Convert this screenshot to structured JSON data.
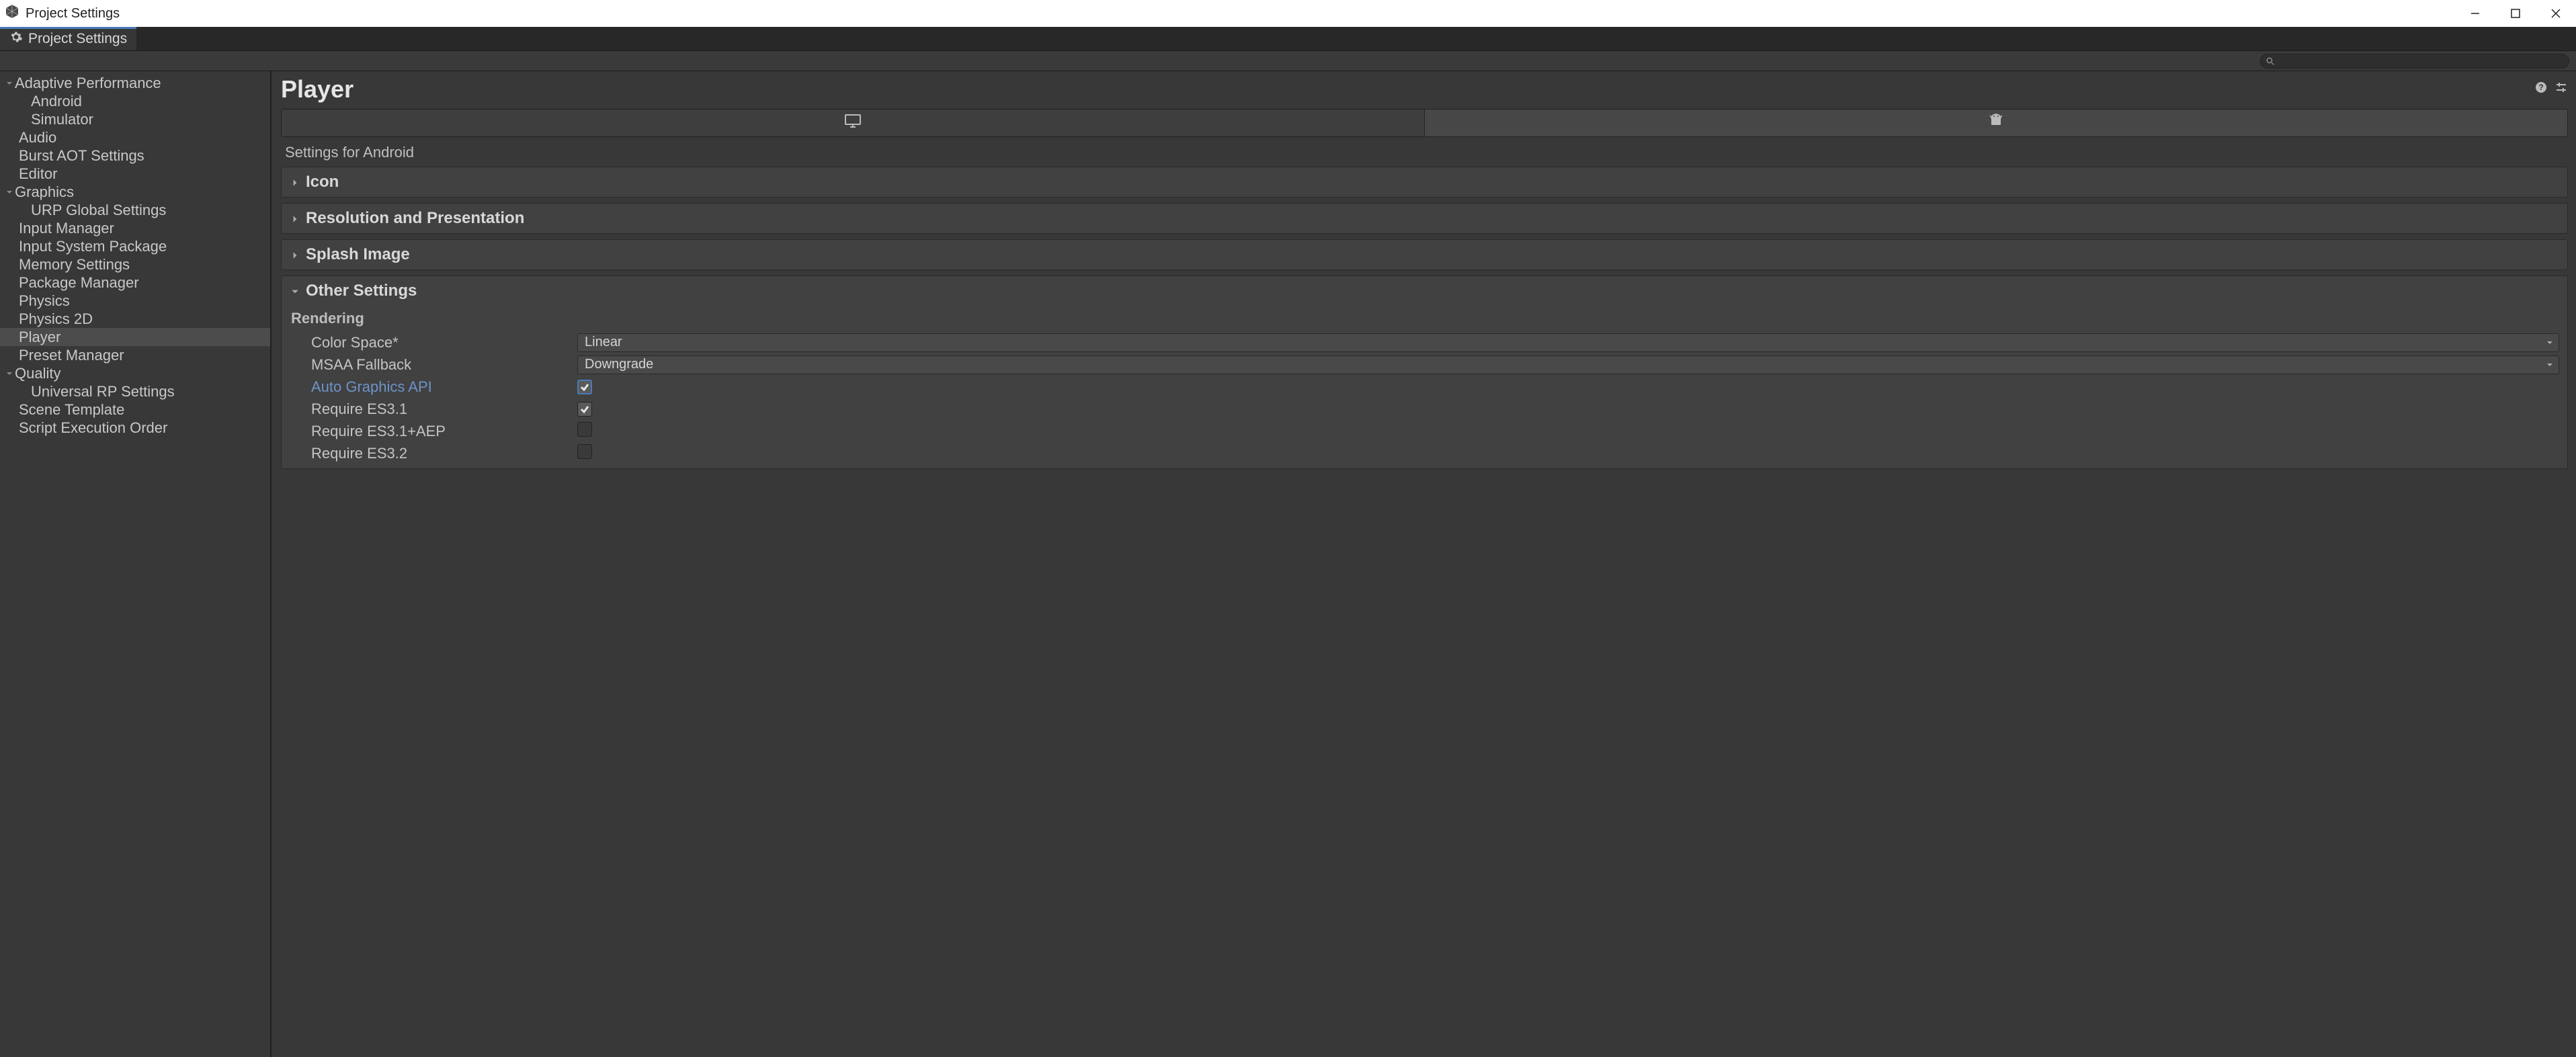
{
  "window": {
    "title": "Project Settings"
  },
  "tab": {
    "label": "Project Settings"
  },
  "search": {
    "placeholder": ""
  },
  "sidebar": {
    "items": {
      "adaptive": "Adaptive Performance",
      "android": "Android",
      "simulator": "Simulator",
      "audio": "Audio",
      "burst": "Burst AOT Settings",
      "editor": "Editor",
      "graphics": "Graphics",
      "urp": "URP Global Settings",
      "input_manager": "Input Manager",
      "input_system": "Input System Package",
      "memory": "Memory Settings",
      "package_manager": "Package Manager",
      "physics": "Physics",
      "physics2d": "Physics 2D",
      "player": "Player",
      "preset": "Preset Manager",
      "quality": "Quality",
      "universal_rp": "Universal RP Settings",
      "scene_template": "Scene Template",
      "script_exec": "Script Execution Order"
    }
  },
  "content": {
    "title": "Player",
    "subtitle": "Settings for Android",
    "foldouts": {
      "icon": "Icon",
      "resolution": "Resolution and Presentation",
      "splash": "Splash Image",
      "other": "Other Settings"
    },
    "group_rendering": "Rendering",
    "props": {
      "color_space": {
        "label": "Color Space*",
        "value": "Linear"
      },
      "msaa_fallback": {
        "label": "MSAA Fallback",
        "value": "Downgrade"
      },
      "auto_gfx": {
        "label": "Auto Graphics API",
        "checked": true
      },
      "req_es31": {
        "label": "Require ES3.1",
        "checked": true
      },
      "req_es31aep": {
        "label": "Require ES3.1+AEP",
        "checked": false
      },
      "req_es32": {
        "label": "Require ES3.2",
        "checked": false
      }
    }
  }
}
